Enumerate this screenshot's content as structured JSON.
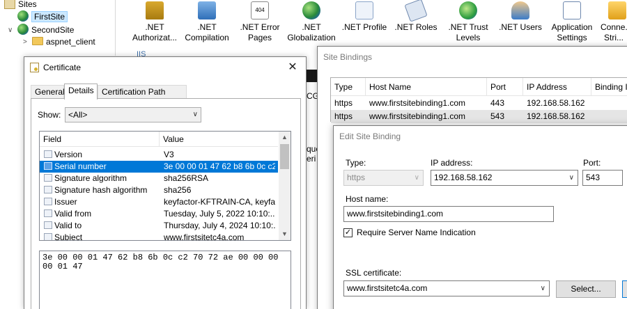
{
  "tree": {
    "items": [
      {
        "label": "Sites",
        "icon": "sites-icon"
      },
      {
        "label": "FirstSite",
        "icon": "globe-icon"
      },
      {
        "label": "SecondSite",
        "icon": "globe-icon"
      },
      {
        "label": "aspnet_client",
        "icon": "folder-icon"
      }
    ]
  },
  "features": {
    "items": [
      {
        "label": ".NET Authorizat...",
        "icon": "lock-icon"
      },
      {
        "label": ".NET Compilation",
        "icon": "compilation-icon"
      },
      {
        "label": ".NET Error Pages",
        "icon": "error-page-icon",
        "icon_text": "404"
      },
      {
        "label": ".NET Globalization",
        "icon": "globe-icon"
      },
      {
        "label": ".NET Profile",
        "icon": "profile-icon"
      },
      {
        "label": ".NET Roles",
        "icon": "roles-icon"
      },
      {
        "label": ".NET Trust Levels",
        "icon": "trust-icon"
      },
      {
        "label": ".NET Users",
        "icon": "users-icon"
      },
      {
        "label": "Application Settings",
        "icon": "settings-list-icon"
      },
      {
        "label": "Conne... Stri...",
        "icon": "connection-strings-icon"
      }
    ],
    "group_label": "IIS",
    "partial_cgi": "CGI",
    "partial_que": "que",
    "partial_eri": "eri"
  },
  "certificate_dialog": {
    "title": "Certificate",
    "tabs": [
      "General",
      "Details",
      "Certification Path"
    ],
    "active_tab": "Details",
    "show_label": "Show:",
    "show_value": "<All>",
    "columns": [
      "Field",
      "Value"
    ],
    "rows": [
      {
        "field": "Version",
        "value": "V3"
      },
      {
        "field": "Serial number",
        "value": "3e 00 00 01 47 62 b8 6b 0c c2..."
      },
      {
        "field": "Signature algorithm",
        "value": "sha256RSA"
      },
      {
        "field": "Signature hash algorithm",
        "value": "sha256"
      },
      {
        "field": "Issuer",
        "value": "keyfactor-KFTRAIN-CA, keyfa..."
      },
      {
        "field": "Valid from",
        "value": "Tuesday, July 5, 2022 10:10:..."
      },
      {
        "field": "Valid to",
        "value": "Thursday, July 4, 2024 10:10:..."
      },
      {
        "field": "Subject",
        "value": "www.firstsitetc4a.com"
      }
    ],
    "selected_row": "Serial number",
    "detail_value": "3e 00 00 01 47 62 b8 6b 0c c2 70 72 ae 00 00 00 00 01 47"
  },
  "site_bindings_dialog": {
    "title": "Site Bindings",
    "columns": [
      "Type",
      "Host Name",
      "Port",
      "IP Address",
      "Binding I"
    ],
    "rows": [
      {
        "type": "https",
        "host": "www.firstsitebinding1.com",
        "port": "443",
        "ip": "192.168.58.162"
      },
      {
        "type": "https",
        "host": "www.firstsitebinding1.com",
        "port": "543",
        "ip": "192.168.58.162"
      }
    ]
  },
  "edit_binding_dialog": {
    "title": "Edit Site Binding",
    "type_label": "Type:",
    "type_value": "https",
    "ip_label": "IP address:",
    "ip_value": "192.168.58.162",
    "port_label": "Port:",
    "port_value": "543",
    "host_label": "Host name:",
    "host_value": "www.firstsitebinding1.com",
    "sni_label": "Require Server Name Indication",
    "sni_checked": true,
    "ssl_label": "SSL certificate:",
    "ssl_value": "www.firstsitetc4a.com",
    "select_button": "Select..."
  }
}
